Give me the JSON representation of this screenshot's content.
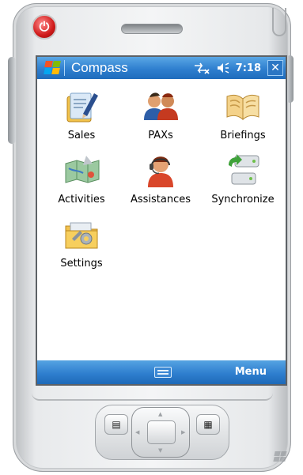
{
  "window": {
    "title": "Compass",
    "time": "7:18",
    "close_label": "✕",
    "status_icons": [
      "connectivity-icon",
      "volume-icon"
    ]
  },
  "apps": [
    {
      "label": "Sales",
      "icon": "sales-icon"
    },
    {
      "label": "PAXs",
      "icon": "paxs-icon"
    },
    {
      "label": "Briefings",
      "icon": "briefings-icon"
    },
    {
      "label": "Activities",
      "icon": "activities-icon"
    },
    {
      "label": "Assistances",
      "icon": "assistances-icon"
    },
    {
      "label": "Synchronize",
      "icon": "synchronize-icon"
    },
    {
      "label": "Settings",
      "icon": "settings-icon"
    }
  ],
  "menubar": {
    "menu_label": "Menu",
    "keyboard_icon": "keyboard-icon"
  },
  "colors": {
    "titlebar": "#2f7fcf",
    "power": "#d01a1a"
  }
}
